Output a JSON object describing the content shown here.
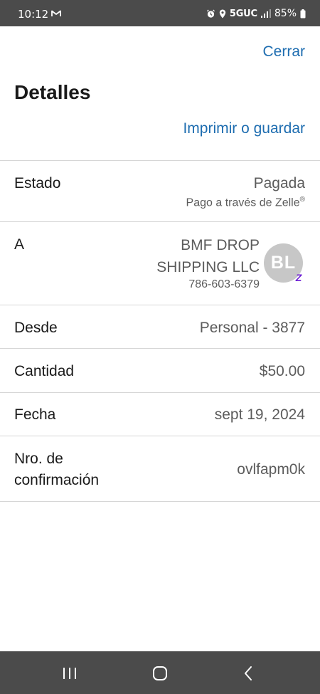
{
  "status_bar": {
    "time": "10:12",
    "network": "5GUC",
    "battery": "85%"
  },
  "header": {
    "close_label": "Cerrar",
    "title": "Detalles",
    "print_label": "Imprimir o guardar"
  },
  "details": {
    "status": {
      "label": "Estado",
      "value": "Pagada",
      "sub": "Pago a través de Zelle",
      "sub_mark": "®"
    },
    "recipient": {
      "label": "A",
      "name_line1": "BMF DROP",
      "name_line2": "SHIPPING LLC",
      "phone": "786-603-6379",
      "initials": "BL",
      "badge": "Z"
    },
    "from": {
      "label": "Desde",
      "value": "Personal - 3877"
    },
    "amount": {
      "label": "Cantidad",
      "value": "$50.00"
    },
    "date": {
      "label": "Fecha",
      "value": "sept 19, 2024"
    },
    "confirmation": {
      "label_line1": "Nro. de",
      "label_line2": "confirmación",
      "value": "ovlfapm0k"
    }
  },
  "icons": {
    "status_bar": [
      "gmail-icon",
      "alarm-icon",
      "location-icon",
      "signal-icon",
      "battery-icon"
    ],
    "nav_bar": [
      "recent-apps-icon",
      "home-icon",
      "back-icon"
    ]
  },
  "colors": {
    "accent_link": "#1e6db0",
    "zelle_purple": "#6d1ed4",
    "system_bar": "#4b4b4b"
  }
}
